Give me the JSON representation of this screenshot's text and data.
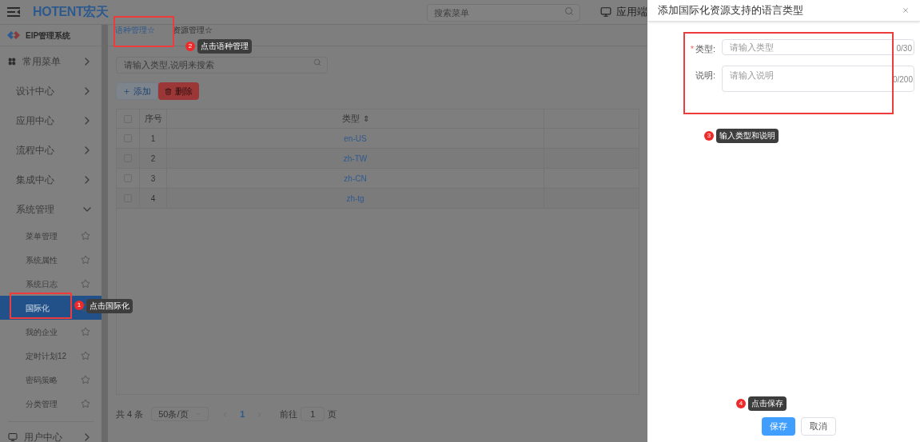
{
  "header": {
    "logo": "HOTENT宏天",
    "search": {
      "placeholder": "搜索菜单"
    },
    "app_link": "应用端"
  },
  "sidebar": {
    "title": "EIP管理系统",
    "items": [
      {
        "label": "常用菜单",
        "kind": "top",
        "expanded": false
      },
      {
        "label": "设计中心",
        "kind": "group",
        "expanded": false
      },
      {
        "label": "应用中心",
        "kind": "group",
        "expanded": false
      },
      {
        "label": "流程中心",
        "kind": "group",
        "expanded": false
      },
      {
        "label": "集成中心",
        "kind": "group",
        "expanded": false
      },
      {
        "label": "系统管理",
        "kind": "group",
        "expanded": true,
        "children": [
          {
            "label": "菜单管理",
            "selected": false
          },
          {
            "label": "系统属性",
            "selected": false
          },
          {
            "label": "系统日志",
            "selected": false
          },
          {
            "label": "国际化",
            "selected": true
          },
          {
            "label": "我的企业",
            "selected": false
          },
          {
            "label": "定时计划12",
            "selected": false
          },
          {
            "label": "密码策略",
            "selected": false
          },
          {
            "label": "分类管理",
            "selected": false
          }
        ]
      },
      {
        "label": "用户中心",
        "kind": "user",
        "expanded": false
      }
    ]
  },
  "tabs": [
    {
      "label": "语种管理☆",
      "selected": true
    },
    {
      "label": "资源管理☆",
      "selected": false
    }
  ],
  "search": {
    "placeholder": "请输入类型,说明来搜索"
  },
  "toolbar": [
    {
      "label": "添加",
      "kind": "add"
    },
    {
      "label": "删除",
      "kind": "delete"
    }
  ],
  "table": {
    "columns": [
      "序号",
      "类型"
    ],
    "sort_mark": "⇕",
    "header_checked": false,
    "rows": [
      {
        "index": "1",
        "type": "en-US",
        "checked": false
      },
      {
        "index": "2",
        "type": "zh-TW",
        "checked": false
      },
      {
        "index": "3",
        "type": "zh-CN",
        "checked": false
      },
      {
        "index": "4",
        "type": "zh-tg",
        "checked": false
      }
    ]
  },
  "pagination": {
    "total": "共 4 条",
    "page_size": "50条/页",
    "current_page": "1",
    "goto_label": "前往",
    "goto_value": "1",
    "page_unit": "页"
  },
  "drawer": {
    "title": "添加国际化资源支持的语言类型",
    "required_mark": "*",
    "fields": [
      {
        "label": "类型:",
        "kind": "input",
        "required": true,
        "placeholder": "请输入类型",
        "counter": "0/30"
      },
      {
        "label": "说明:",
        "kind": "textarea",
        "required": false,
        "placeholder": "请输入说明",
        "counter": "0/200"
      }
    ],
    "buttons": [
      {
        "label": "保存",
        "kind": "primary"
      },
      {
        "label": "取消",
        "kind": "default"
      }
    ]
  },
  "annotations": [
    {
      "number": "1",
      "text": "点击国际化"
    },
    {
      "number": "2",
      "text": "点击语种管理"
    },
    {
      "number": "3",
      "text": "输入类型和说明"
    },
    {
      "number": "4",
      "text": "点击保存"
    }
  ]
}
